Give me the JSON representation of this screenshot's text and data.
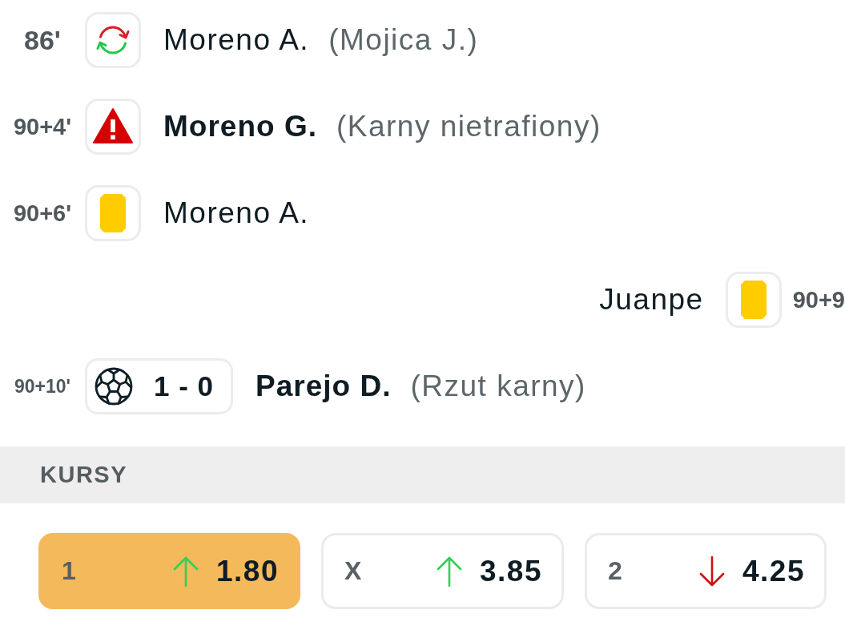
{
  "events": [
    {
      "minute": "86'",
      "away": false,
      "kind": "substitution",
      "player": "Moreno A.",
      "detail": "(Mojica J.)"
    },
    {
      "minute": "90+4'",
      "away": false,
      "kind": "missed_penalty",
      "player": "Moreno G.",
      "detail": "(Karny nietrafiony)"
    },
    {
      "minute": "90+6'",
      "away": false,
      "kind": "yellow_card",
      "player": "Moreno A."
    },
    {
      "minute": "90+9",
      "away": true,
      "kind": "yellow_card",
      "player": "Juanpe"
    },
    {
      "minute": "90+10'",
      "away": false,
      "kind": "goal",
      "score": "1 - 0",
      "player": "Parejo D.",
      "detail": "(Rzut karny)"
    }
  ],
  "odds": {
    "title": "KURSY",
    "options": [
      {
        "label": "1",
        "rising": true,
        "value": "1.80",
        "selected": true
      },
      {
        "label": "X",
        "rising": true,
        "value": "3.85",
        "selected": false
      },
      {
        "label": "2",
        "rising": false,
        "value": "4.25",
        "selected": false
      }
    ]
  }
}
